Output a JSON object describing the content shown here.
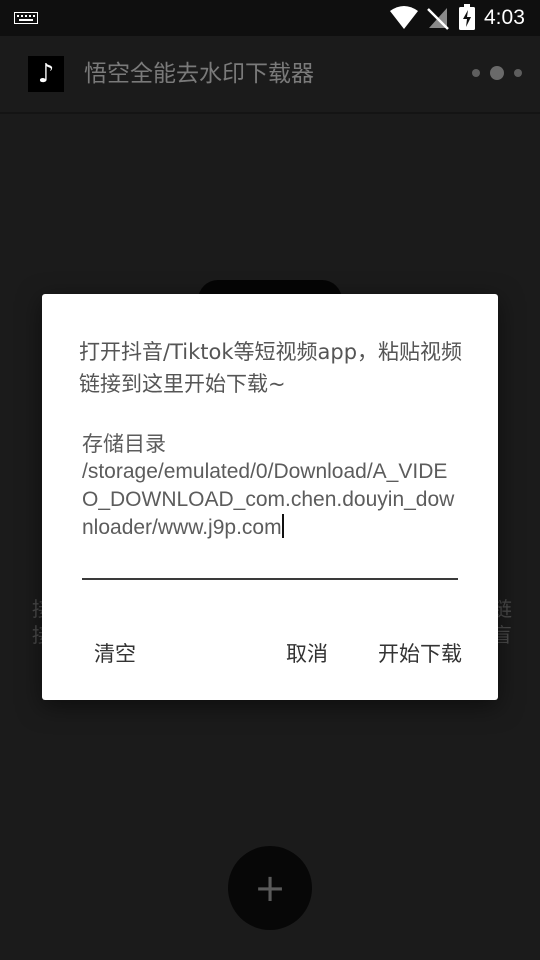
{
  "status_bar": {
    "time": "4:03",
    "icons": [
      "keyboard-icon",
      "wifi-icon",
      "no-signal-icon",
      "battery-charging-icon"
    ]
  },
  "app_bar": {
    "title": "悟空全能去水印下载器",
    "logo_glyph": "♪",
    "menu_icon": "more-dots-icon"
  },
  "background": {
    "left_text": "接\n接",
    "right_text": "链\n盲",
    "fab_glyph": "+"
  },
  "dialog": {
    "message": "打开抖音/Tiktok等短视频app，粘贴视频链接到这里开始下载~",
    "field_label": "存储目录",
    "field_value": "/storage/emulated/0/Download/A_VIDEO_DOWNLOAD_com.chen.douyin_downloader/www.j9p.com",
    "buttons": {
      "clear": "清空",
      "cancel": "取消",
      "start": "开始下载"
    }
  },
  "colors": {
    "background": "#1b1b1b",
    "dialog": "#ffffff",
    "status_bar": "#0f0f0f"
  }
}
